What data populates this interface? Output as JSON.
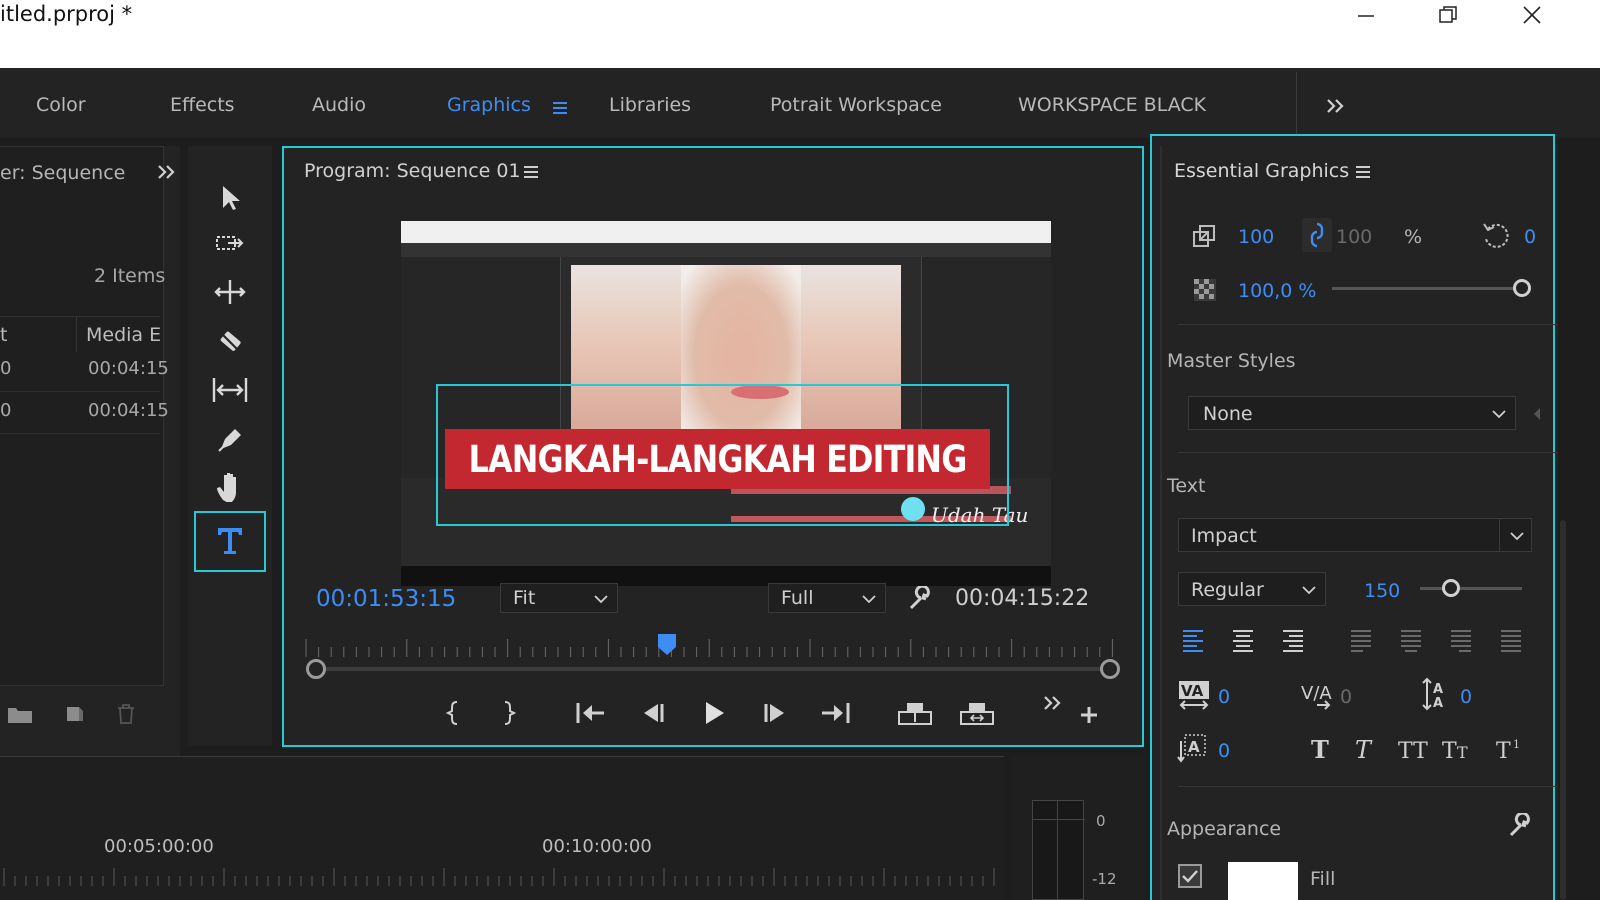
{
  "window": {
    "title": "itled.prproj *"
  },
  "tabs": [
    {
      "label": "Color"
    },
    {
      "label": "Effects"
    },
    {
      "label": "Audio"
    },
    {
      "label": "Graphics"
    },
    {
      "label": "Libraries"
    },
    {
      "label": "Potrait Workspace"
    },
    {
      "label": "WORKSPACE BLACK"
    }
  ],
  "project": {
    "title": "er: Sequence",
    "items_count": "2 Items",
    "col_name": "t",
    "col_media": "Media E",
    "rows": [
      {
        "name": "0",
        "media": "00:04:15"
      },
      {
        "name": "0",
        "media": "00:04:15"
      }
    ]
  },
  "program": {
    "title": "Program: Sequence 01",
    "timecode": "00:01:53:15",
    "fit": "Fit",
    "quality": "Full",
    "duration": "00:04:15:22",
    "playhead_fraction": 0.43
  },
  "video": {
    "headline": "LANGKAH-LANGKAH EDITING",
    "signature": "Udah Tau"
  },
  "essential_graphics": {
    "title": "Essential Graphics",
    "scale": "100",
    "scale_linked": "100",
    "percent": "%",
    "rotation": "0",
    "opacity": "100,0 %",
    "opacity_fraction": 1.0,
    "master_styles_label": "Master Styles",
    "master_style_value": "None",
    "text_label": "Text",
    "font": "Impact",
    "font_style": "Regular",
    "font_size": "150",
    "font_size_fraction": 0.3,
    "kerning": "0",
    "tracking": "0",
    "leading": "0",
    "baseline": "0",
    "appearance_label": "Appearance",
    "fill_label": "Fill"
  },
  "timeline": {
    "ruler_a": "00:05:00:00",
    "ruler_b": "00:10:00:00",
    "meter_0": "0",
    "meter_12": "-12"
  },
  "colors": {
    "accent": "#3d8df5",
    "highlight": "#29c8d6",
    "banner": "#d92b33"
  }
}
